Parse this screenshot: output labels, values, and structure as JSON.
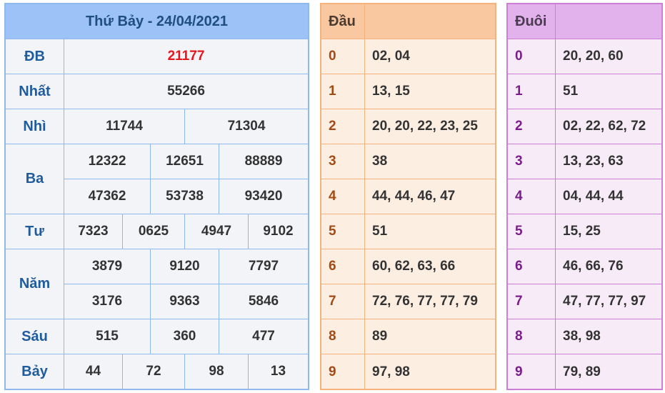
{
  "results": {
    "title": "Thứ Bảy - 24/04/2021",
    "db": {
      "label": "ĐB",
      "value": "21177"
    },
    "nhat": {
      "label": "Nhất",
      "value": "55266"
    },
    "nhi": {
      "label": "Nhì",
      "values": [
        "11744",
        "71304"
      ]
    },
    "ba": {
      "label": "Ba",
      "values": [
        "12322",
        "12651",
        "88889",
        "47362",
        "53738",
        "93420"
      ]
    },
    "tu": {
      "label": "Tư",
      "values": [
        "7323",
        "0625",
        "4947",
        "9102"
      ]
    },
    "nam": {
      "label": "Năm",
      "values": [
        "3879",
        "9120",
        "7797",
        "3176",
        "9363",
        "5846"
      ]
    },
    "sau": {
      "label": "Sáu",
      "values": [
        "515",
        "360",
        "477"
      ]
    },
    "bay": {
      "label": "Bảy",
      "values": [
        "44",
        "72",
        "98",
        "13"
      ]
    }
  },
  "dau": {
    "header": "Đầu",
    "rows": [
      {
        "digit": "0",
        "values": "02, 04"
      },
      {
        "digit": "1",
        "values": "13, 15"
      },
      {
        "digit": "2",
        "values": "20, 20, 22, 23, 25"
      },
      {
        "digit": "3",
        "values": "38"
      },
      {
        "digit": "4",
        "values": "44, 44, 46, 47"
      },
      {
        "digit": "5",
        "values": "51"
      },
      {
        "digit": "6",
        "values": "60, 62, 63, 66"
      },
      {
        "digit": "7",
        "values": "72, 76, 77, 77, 79"
      },
      {
        "digit": "8",
        "values": "89"
      },
      {
        "digit": "9",
        "values": "97, 98"
      }
    ]
  },
  "duoi": {
    "header": "Đuôi",
    "rows": [
      {
        "digit": "0",
        "values": "20, 20, 60"
      },
      {
        "digit": "1",
        "values": "51"
      },
      {
        "digit": "2",
        "values": "02, 22, 62, 72"
      },
      {
        "digit": "3",
        "values": "13, 23, 63"
      },
      {
        "digit": "4",
        "values": "04, 44, 44"
      },
      {
        "digit": "5",
        "values": "15, 25"
      },
      {
        "digit": "6",
        "values": "46, 66, 76"
      },
      {
        "digit": "7",
        "values": "47, 77, 77, 97"
      },
      {
        "digit": "8",
        "values": "38, 98"
      },
      {
        "digit": "9",
        "values": "79, 89"
      }
    ]
  },
  "colors": {
    "results_border": "#8fb8ee",
    "results_header": "#9cc2f7",
    "dau_border": "#f5b27c",
    "dau_header": "#f9c7a0",
    "duoi_border": "#cd7fd8",
    "duoi_header": "#e2b2ec",
    "special_prize": "#e8161b"
  }
}
